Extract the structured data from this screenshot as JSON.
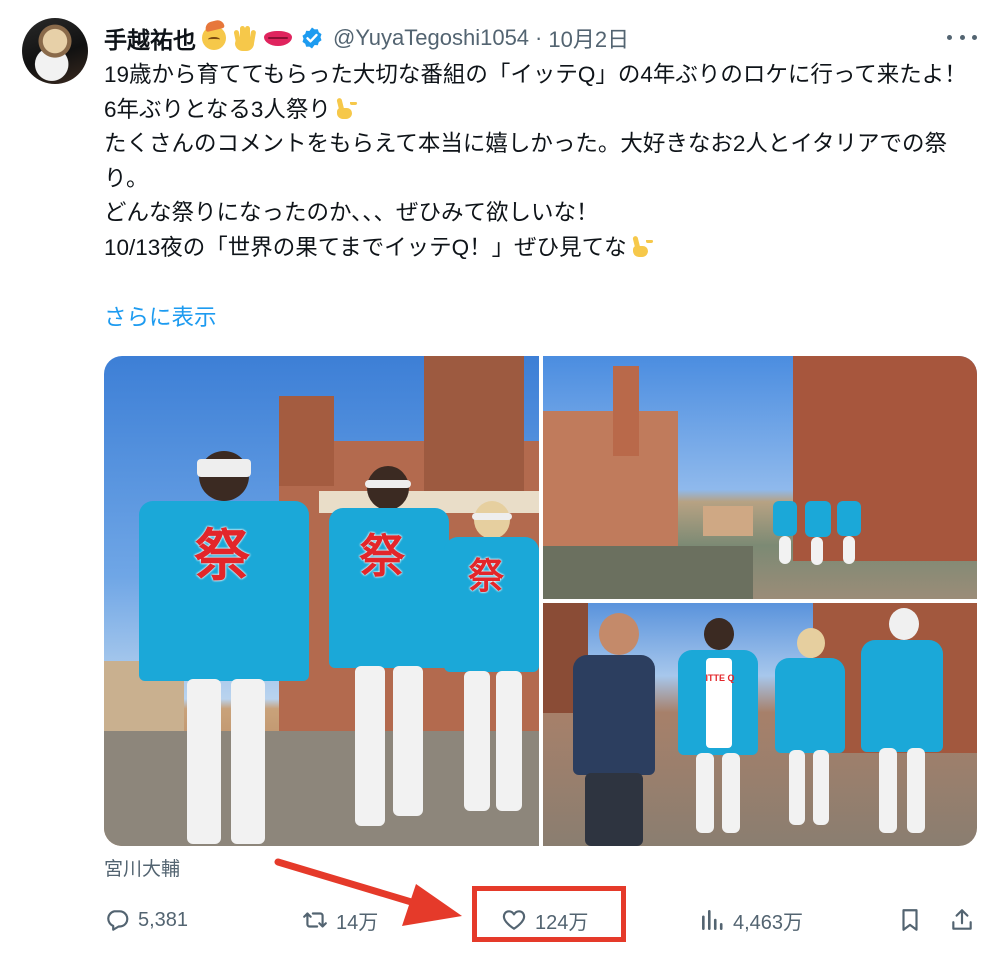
{
  "author": {
    "name": "手越祐也",
    "handle": "@YuyaTegoshi1054",
    "separator": "·",
    "date": "10月2日",
    "verified": true,
    "emojis": [
      "face-with-cowboy-hat-emoji",
      "raised-hand-emoji",
      "lips-emoji"
    ]
  },
  "tweet": {
    "lines": [
      "19歳から育ててもらった大切な番組の「イッテQ」の4年ぶりのロケに行って来たよ！",
      "6年ぶりとなる3人祭り",
      "たくさんのコメントをもらえて本当に嬉しかった。大好きなお2人とイタリアでの祭り。",
      "どんな祭りになったのか、、、ぜひみて欲しいな！",
      "10/13夜の「世界の果てまでイッテQ！」ぜひ見てな"
    ],
    "show_more": "さらに表示"
  },
  "media": {
    "photo_kanji": "祭",
    "shirt_text": "ITTE Q",
    "credit": "宮川大輔"
  },
  "actions": {
    "replies": "5,381",
    "reposts": "14万",
    "likes": "124万",
    "views": "4,463万"
  },
  "annotation": {
    "highlight_color": "#e53a2a",
    "accent_color": "#1d9bf0"
  }
}
